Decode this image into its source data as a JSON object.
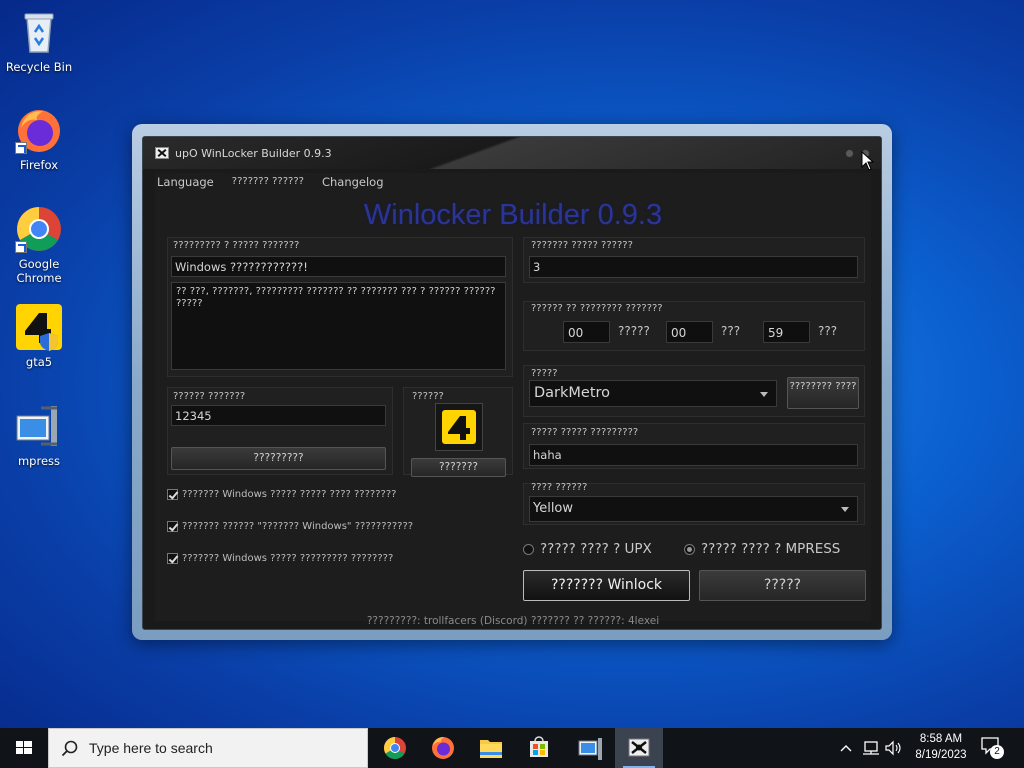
{
  "desktop": {
    "icons": [
      {
        "label": "Recycle Bin"
      },
      {
        "label": "Firefox"
      },
      {
        "label": "Google Chrome"
      },
      {
        "label": "gta5"
      },
      {
        "label": "mpress"
      }
    ]
  },
  "window": {
    "title": "upO WinLocker Builder 0.9.3",
    "menu": [
      "Language",
      "??????? ??????",
      "Changelog"
    ],
    "big_title": "Winlocker Builder 0.9.3",
    "left": {
      "text_group_label": "????????? ? ????? ???????",
      "header_value": "Windows ????????????!",
      "body_value": "?? ???, ???????, ????????? ??????? ?? ??????? ??? ? ?????? ?????? ?????",
      "password_group_label": "?????? ???????",
      "password_value": "12345",
      "generate_button": "?????????",
      "icon_group_label": "??????",
      "icon_button": "???????",
      "checkboxes": [
        "??????? Windows ????? ????? ???? ????????",
        "??????? ?????? \"??????? Windows\" ???????????",
        "??????? Windows ????? ????????? ????????"
      ]
    },
    "right": {
      "attempts_label": "??????? ????? ??????",
      "attempts_value": "3",
      "timer_label": "?????? ?? ???????? ???????",
      "timer": [
        {
          "value": "00",
          "unit": "?????"
        },
        {
          "value": "00",
          "unit": "???"
        },
        {
          "value": "59",
          "unit": "???"
        }
      ],
      "theme_label": "?????",
      "theme_value": "DarkMetro",
      "theme_button": "???????? ????",
      "secret_label": "????? ????? ?????????",
      "secret_value": "haha",
      "color_label": "???? ??????",
      "color_value": "Yellow",
      "radio_upx": "????? ???? ? UPX",
      "radio_mpress": "????? ???? ? MPRESS",
      "build_button": "??????? Winlock",
      "exit_button": "?????"
    },
    "footer": "?????????: trollfacers (Discord) ??????? ?? ??????: 4lexei"
  },
  "taskbar": {
    "search_placeholder": "Type here to search",
    "time": "8:58 AM",
    "date": "8/19/2023",
    "notification_count": "2"
  }
}
